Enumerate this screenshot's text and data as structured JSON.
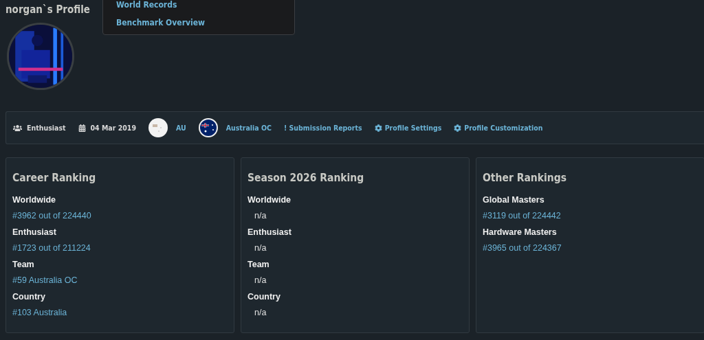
{
  "profile": {
    "title": "norgan`s Profile"
  },
  "menu": {
    "items": [
      {
        "label": "World Records"
      },
      {
        "label": "Benchmark Overview"
      }
    ]
  },
  "info_bar": [
    {
      "kind": "role",
      "text": "Enthusiast"
    },
    {
      "kind": "date",
      "text": "04 Mar 2019"
    },
    {
      "kind": "region",
      "text": "AU"
    },
    {
      "kind": "team",
      "text": "Australia OC"
    },
    {
      "kind": "reports",
      "text": "! Submission Reports"
    },
    {
      "kind": "settings",
      "text": "Profile Settings"
    },
    {
      "kind": "settings",
      "text": "Profile Customization"
    }
  ],
  "cards": [
    {
      "title": "Career Ranking",
      "entries": [
        {
          "label": "Worldwide",
          "value": "#3962 out of 224440",
          "linked": true
        },
        {
          "label": "Enthusiast",
          "value": "#1723 out of 211224",
          "linked": true
        },
        {
          "label": "Team",
          "value": "#59 Australia OC",
          "linked": true
        },
        {
          "label": "Country",
          "value": "#103 Australia",
          "linked": true
        }
      ]
    },
    {
      "title": "Season 2026 Ranking",
      "entries": [
        {
          "label": "Worldwide",
          "value": "n/a",
          "linked": false
        },
        {
          "label": "Enthusiast",
          "value": "n/a",
          "linked": false
        },
        {
          "label": "Team",
          "value": "n/a",
          "linked": false
        },
        {
          "label": "Country",
          "value": "n/a",
          "linked": false
        }
      ]
    },
    {
      "title": "Other Rankings",
      "entries": [
        {
          "label": "Global Masters",
          "value": "#3119 out of 224442",
          "linked": true
        },
        {
          "label": "Hardware Masters",
          "value": "#3965 out of 224367",
          "linked": true
        }
      ]
    }
  ]
}
